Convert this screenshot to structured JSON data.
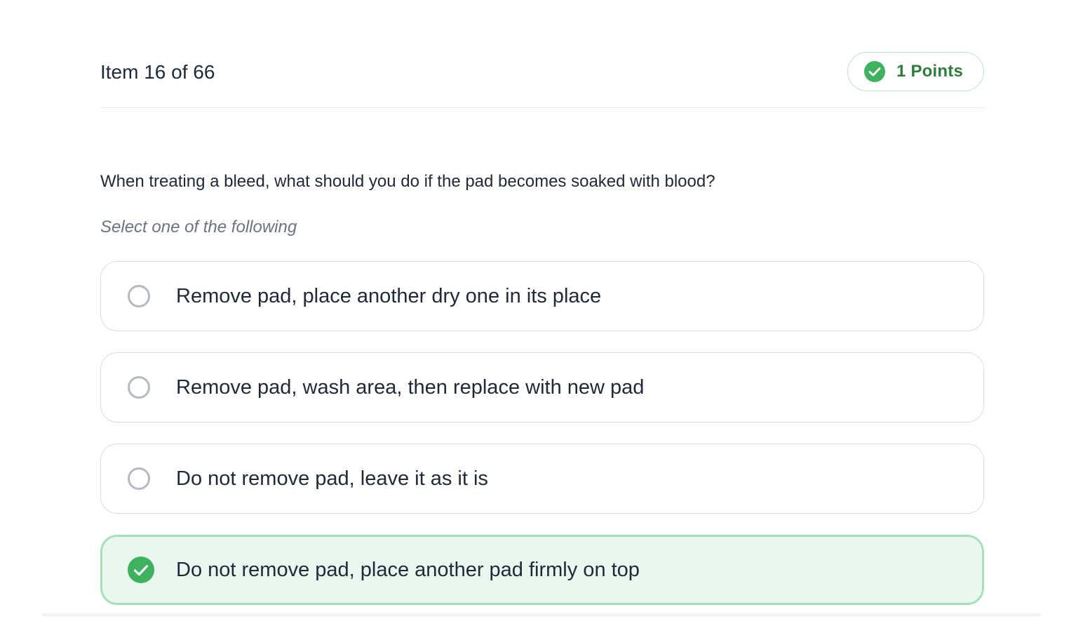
{
  "header": {
    "item_counter": "Item 16 of 66",
    "points_label": "1 Points",
    "badge_icon": "check-circle-icon"
  },
  "question": {
    "text": "When treating a bleed, what should you do if the pad becomes soaked with blood?",
    "instruction": "Select one of the following"
  },
  "options": [
    {
      "label": "Remove pad, place another dry one in its place",
      "selected": false
    },
    {
      "label": "Remove pad, wash area, then replace with new pad",
      "selected": false
    },
    {
      "label": "Do not remove pad, leave it as it is",
      "selected": false
    },
    {
      "label": "Do not remove pad, place another pad firmly on top",
      "selected": true
    }
  ],
  "colors": {
    "accent_green": "#3fb25f",
    "selected_background": "#e9f7ee",
    "selected_border": "#a8e0bb",
    "points_text": "#2e7d3e"
  }
}
